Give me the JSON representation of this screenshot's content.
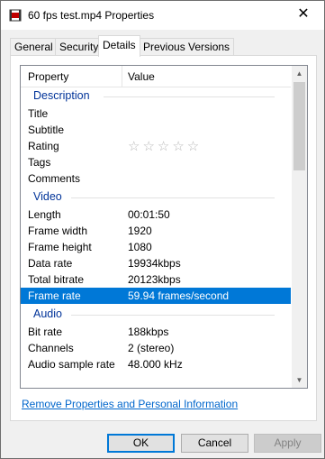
{
  "window": {
    "title": "60 fps test.mp4 Properties",
    "close_glyph": "✕"
  },
  "tabs": [
    {
      "label": "General"
    },
    {
      "label": "Security"
    },
    {
      "label": "Details",
      "active": true
    },
    {
      "label": "Previous Versions"
    }
  ],
  "list": {
    "headers": {
      "property": "Property",
      "value": "Value"
    },
    "groups": {
      "description": "Description",
      "video": "Video",
      "audio": "Audio"
    },
    "description_rows": [
      {
        "p": "Title",
        "v": ""
      },
      {
        "p": "Subtitle",
        "v": ""
      },
      {
        "p": "Rating",
        "v": ""
      },
      {
        "p": "Tags",
        "v": ""
      },
      {
        "p": "Comments",
        "v": ""
      }
    ],
    "rating_stars": "☆☆☆☆☆",
    "video_rows": [
      {
        "p": "Length",
        "v": "00:01:50"
      },
      {
        "p": "Frame width",
        "v": "1920"
      },
      {
        "p": "Frame height",
        "v": "1080"
      },
      {
        "p": "Data rate",
        "v": "19934kbps"
      },
      {
        "p": "Total bitrate",
        "v": "20123kbps"
      },
      {
        "p": "Frame rate",
        "v": "59.94 frames/second",
        "selected": true
      }
    ],
    "audio_rows": [
      {
        "p": "Bit rate",
        "v": "188kbps"
      },
      {
        "p": "Channels",
        "v": "2 (stereo)"
      },
      {
        "p": "Audio sample rate",
        "v": "48.000 kHz"
      }
    ]
  },
  "remove_link": "Remove Properties and Personal Information",
  "buttons": {
    "ok": "OK",
    "cancel": "Cancel",
    "apply": "Apply"
  },
  "colors": {
    "selection": "#0078d7",
    "group_header": "#003399",
    "link": "#0066cc"
  }
}
